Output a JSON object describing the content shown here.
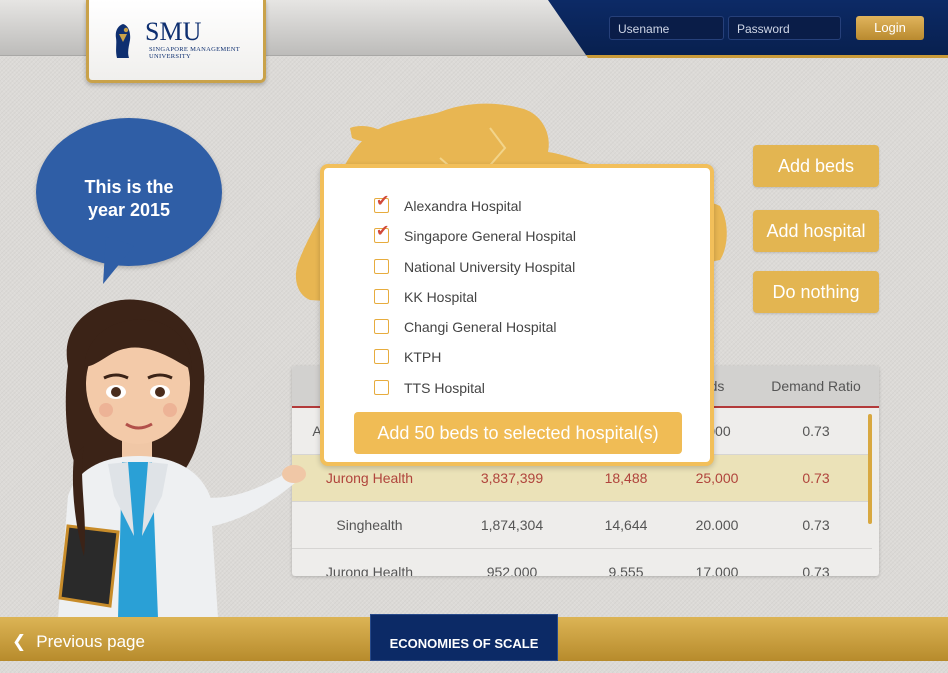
{
  "header": {
    "logo_text": "SMU",
    "logo_subtitle": "SINGAPORE MANAGEMENT UNIVERSITY",
    "username_placeholder": "Usename",
    "password_placeholder": "Password",
    "login_label": "Login"
  },
  "bubble": {
    "line1": "This is the",
    "line2": "year 2015"
  },
  "actions": {
    "add_beds": "Add beds",
    "add_hospital": "Add hospital",
    "do_nothing": "Do nothing"
  },
  "table": {
    "headers": [
      "",
      "",
      "",
      "ds",
      "Demand Ratio"
    ],
    "rows": [
      [
        "A",
        "",
        "",
        ",000",
        "0.73"
      ],
      [
        "Jurong Health",
        "3,837,399",
        "18,488",
        "25,000",
        "0.73"
      ],
      [
        "Singhealth",
        "1,874,304",
        "14,644",
        "20.000",
        "0.73"
      ],
      [
        "Jurong Health",
        "952,000",
        "9,555",
        "17,000",
        "0.73"
      ]
    ]
  },
  "modal": {
    "options": [
      {
        "label": "Alexandra Hospital",
        "checked": true
      },
      {
        "label": "Singapore General Hospital",
        "checked": true
      },
      {
        "label": "National University Hospital",
        "checked": false
      },
      {
        "label": "KK Hospital",
        "checked": false
      },
      {
        "label": "Changi General Hospital",
        "checked": false
      },
      {
        "label": "KTPH",
        "checked": false
      },
      {
        "label": "TTS Hospital",
        "checked": false
      }
    ],
    "add_button": "Add 50 beds to selected hospital(s)"
  },
  "footer": {
    "previous_page": "Previous page",
    "section_tab": "ECONOMIES OF SCALE"
  },
  "colors": {
    "navy": "#0c2a66",
    "gold": "#e3b551",
    "bubble_blue": "#2f5ea6",
    "highlight_row": "#ebe2b8"
  }
}
